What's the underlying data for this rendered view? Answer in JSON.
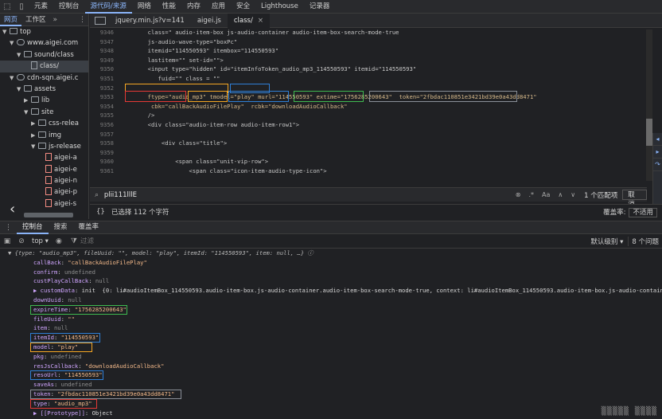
{
  "toolbar": {
    "tabs": [
      "元素",
      "控制台",
      "源代码/来源",
      "网络",
      "性能",
      "内存",
      "应用",
      "安全",
      "Lighthouse",
      "记录器"
    ],
    "active_tab": 2
  },
  "navigator": {
    "tabs": [
      "网页",
      "工作区"
    ],
    "more": "»",
    "tree": [
      {
        "label": "top",
        "depth": 0,
        "arrow": "▼",
        "icon": "frame"
      },
      {
        "label": "www.aigei.com",
        "depth": 1,
        "arrow": "▼",
        "icon": "cloud"
      },
      {
        "label": "sound/class",
        "depth": 2,
        "arrow": "▼",
        "icon": "folder"
      },
      {
        "label": "class/",
        "depth": 3,
        "arrow": "",
        "icon": "file",
        "selected": true
      },
      {
        "label": "cdn-sqn.aigei.c",
        "depth": 1,
        "arrow": "▼",
        "icon": "cloud"
      },
      {
        "label": "assets",
        "depth": 2,
        "arrow": "▼",
        "icon": "folder"
      },
      {
        "label": "lib",
        "depth": 3,
        "arrow": "▶",
        "icon": "folder"
      },
      {
        "label": "site",
        "depth": 3,
        "arrow": "▼",
        "icon": "folder"
      },
      {
        "label": "css-relea",
        "depth": 4,
        "arrow": "▶",
        "icon": "folder"
      },
      {
        "label": "img",
        "depth": 4,
        "arrow": "▶",
        "icon": "folder"
      },
      {
        "label": "js-release",
        "depth": 4,
        "arrow": "▼",
        "icon": "folder"
      },
      {
        "label": "aigei-a",
        "depth": 5,
        "arrow": "",
        "icon": "js"
      },
      {
        "label": "aigei-e",
        "depth": 5,
        "arrow": "",
        "icon": "js"
      },
      {
        "label": "aigei-n",
        "depth": 5,
        "arrow": "",
        "icon": "js"
      },
      {
        "label": "aigei-p",
        "depth": 5,
        "arrow": "",
        "icon": "js"
      },
      {
        "label": "aigei-s",
        "depth": 5,
        "arrow": "",
        "icon": "js"
      }
    ]
  },
  "editor": {
    "tabs": [
      "jquery.min.js?v=141",
      "aigei.js",
      "class/"
    ],
    "active_tab": 2,
    "lines": [
      {
        "n": "9346",
        "t": "        class=\" audio-item-box js-audio-container audio-item-box-search-mode-true"
      },
      {
        "n": "9347",
        "t": "        js-audio-wave-type=\"boxPc\""
      },
      {
        "n": "9348",
        "t": "        itemid=\"114550593\" itembox=\"114550593\""
      },
      {
        "n": "9349",
        "t": "        lastitem=\"\" set-id=\"\">"
      },
      {
        "n": "9350",
        "t": "        <input type=\"hidden\" id=\"itemInfoToken_audio_mp3_114550593\" itemid=\"114550593\""
      },
      {
        "n": "9351",
        "t": "           fuid=\"\" class = \"\""
      },
      {
        "n": "9352",
        "t": ""
      },
      {
        "n": "9353",
        "t": "        ftype=\"audio_mp3\" tmodel=\"play\" murl=\"114550593\" extime=\"1756285200643\"  token=\"2fbdac110851e3421bd39e0a43dd8471\""
      },
      {
        "n": "9354",
        "t": "         cbk=\"callBackAudioFilePlay\"  rcbk=\"downloadAudioCallback\""
      },
      {
        "n": "9355",
        "t": "        />"
      },
      {
        "n": "9356",
        "t": "        <div class=\"audio-item-row audio-item-row1\">"
      },
      {
        "n": "9357",
        "t": ""
      },
      {
        "n": "9358",
        "t": "            <div class=\"title\">"
      },
      {
        "n": "9359",
        "t": ""
      },
      {
        "n": "9360",
        "t": "                <span class=\"unit-vip-row\">"
      },
      {
        "n": "9361",
        "t": "                    <span class=\"icon-item-audio-type-icon\">"
      }
    ]
  },
  "search": {
    "value": "plii111lllE",
    "match_case": "Aa",
    "regex": ".*",
    "count": "1 个匹配项",
    "cancel": "取消"
  },
  "status": {
    "braces": "{}",
    "selection": "已选择 112 个字符",
    "coverage_label": "覆盖率:",
    "coverage_value": "不适用"
  },
  "drawer": {
    "tabs": [
      "控制台",
      "搜索",
      "覆盖率"
    ],
    "active_tab": 0
  },
  "console_toolbar": {
    "context": "top ▾",
    "filter_placeholder": "过滤",
    "levels": "默认级别 ▾",
    "issues": "8 个问题"
  },
  "console": {
    "head": "▼ {type: \"audio_mp3\", fileUuid: \"\", model: \"play\", itemId: \"114550593\", item: null, …} ⓘ",
    "rows": [
      {
        "k": "callBack",
        "v": "\"callBackAudioFilePlay\"",
        "c": "str"
      },
      {
        "k": "confirm",
        "v": "undefined",
        "c": "und"
      },
      {
        "k": "custPlayCallBack",
        "v": "null",
        "c": "und"
      },
      {
        "k": "▶ customData",
        "v": "init  {0: li#audioItemBox_114550593.audio-item-box.js-audio-container.audio-item-box-search-mode-true, context: li#audioItemBox_114550593.audio-item-box.js-audio-container.",
        "c": "plain"
      },
      {
        "k": "downUuid",
        "v": "null",
        "c": "und"
      },
      {
        "k": "expireTime",
        "v": "\"1756285200643\"",
        "c": "str"
      },
      {
        "k": "fileUuid",
        "v": "\"\"",
        "c": "str"
      },
      {
        "k": "item",
        "v": "null",
        "c": "und"
      },
      {
        "k": "itemId",
        "v": "\"114550593\"",
        "c": "str"
      },
      {
        "k": "model",
        "v": "\"play\"",
        "c": "str"
      },
      {
        "k": "pkg",
        "v": "undefined",
        "c": "und"
      },
      {
        "k": "resJsCallback",
        "v": "\"downloadAudioCallback\"",
        "c": "str"
      },
      {
        "k": "resoUrl",
        "v": "\"114550593\"",
        "c": "str"
      },
      {
        "k": "saveAs",
        "v": "undefined",
        "c": "und"
      },
      {
        "k": "token",
        "v": "\"2fbdac110851e3421bd39e0a43dd8471\"",
        "c": "str"
      },
      {
        "k": "type",
        "v": "\"audio_mp3\"",
        "c": "str"
      },
      {
        "k": "▶ [[Prototype]]",
        "v": "Object",
        "c": "plain"
      }
    ]
  },
  "colors": {
    "red": "#e53935",
    "orange": "#f5a623",
    "blue": "#2f7fd6",
    "green": "#3fb950",
    "gray": "#8a8f98"
  }
}
